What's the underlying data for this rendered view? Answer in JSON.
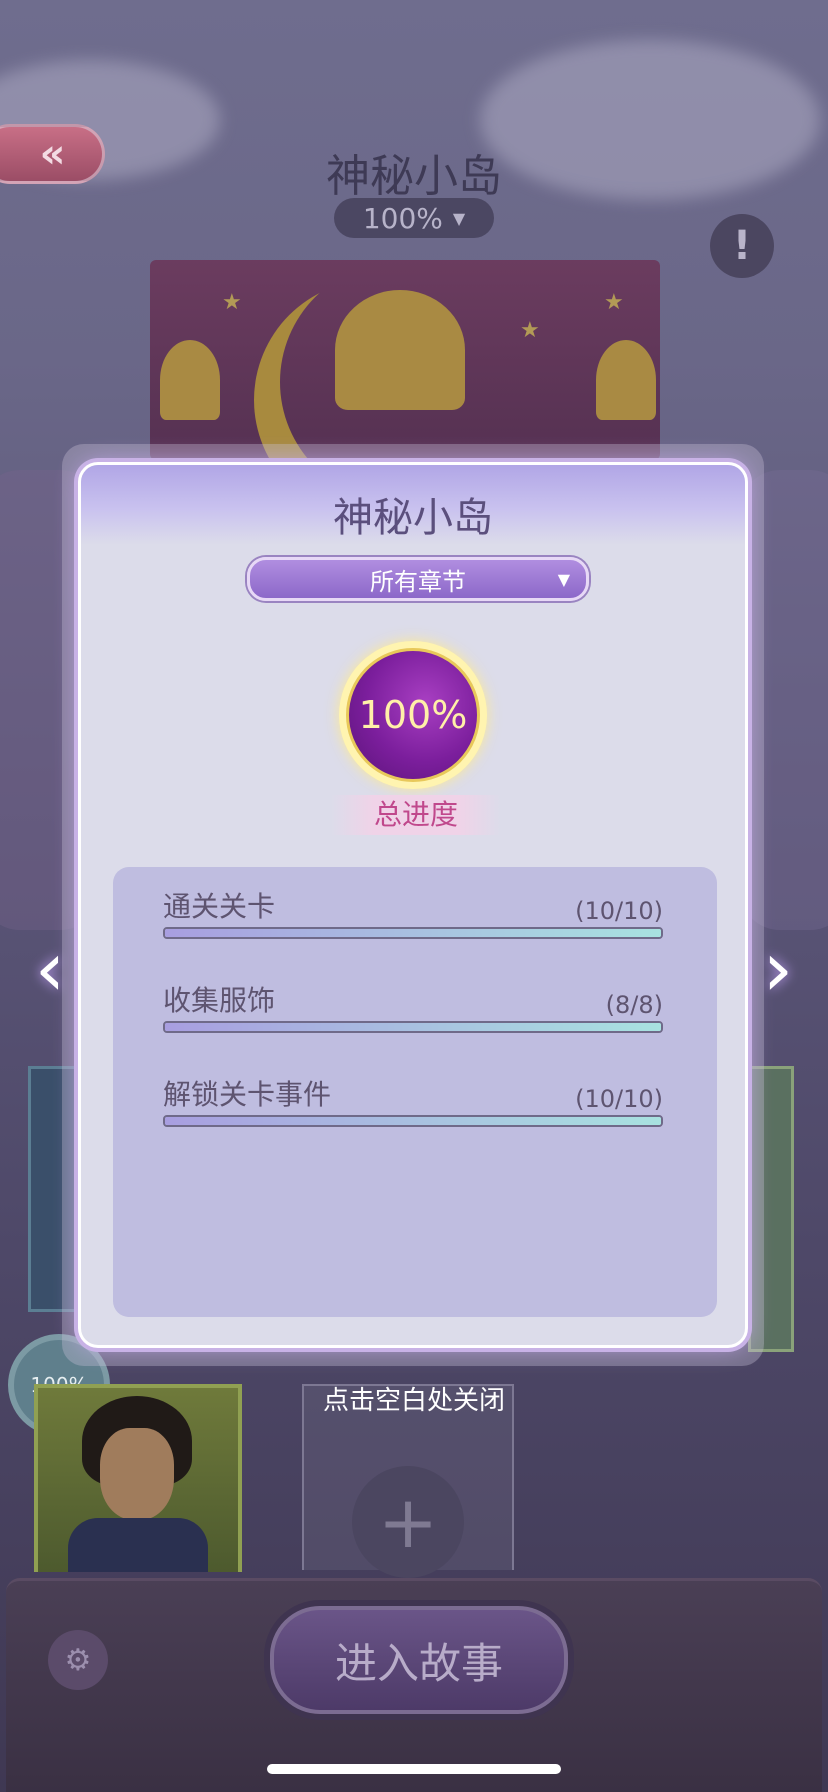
{
  "header": {
    "title": "神秘小岛",
    "progress": "100%",
    "back_icon": "double-chevron-left-icon",
    "info_icon": "exclamation-icon"
  },
  "modal": {
    "title": "神秘小岛",
    "chapter_select": "所有章节",
    "total_progress_value": "100%",
    "total_progress_label": "总进度",
    "stats": [
      {
        "label": "通关关卡",
        "count": "(10/10)",
        "fraction": 1.0
      },
      {
        "label": "收集服饰",
        "count": "(8/8)",
        "fraction": 1.0
      },
      {
        "label": "解锁关卡事件",
        "count": "(10/10)",
        "fraction": 1.0
      }
    ]
  },
  "character_badge": "100%",
  "close_hint": "点击空白处关闭",
  "enter_button": "进入故事",
  "colors": {
    "accent_purple": "#8c68c9",
    "progress_gold": "#fff0a8",
    "bar_fill_start": "#a89ee0",
    "bar_fill_end": "#a8e2e0"
  }
}
